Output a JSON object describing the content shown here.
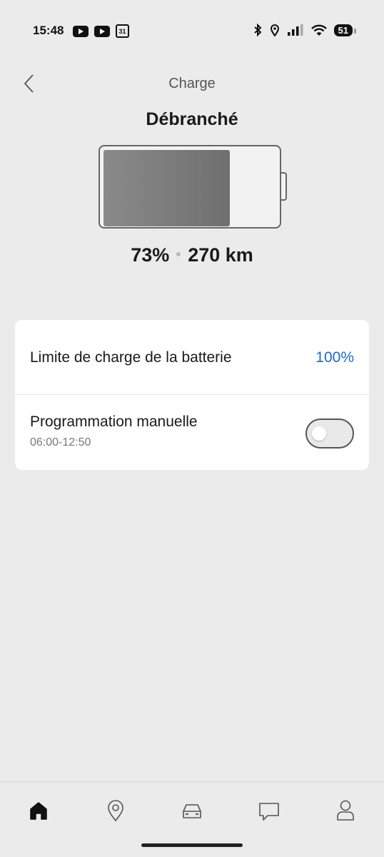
{
  "status_bar": {
    "time": "15:48",
    "calendar_day": "31",
    "battery_level": "51"
  },
  "header": {
    "title": "Charge",
    "state": "Débranché"
  },
  "battery": {
    "charge_fraction": 0.73,
    "percent_text": "73%",
    "range_text": "270 km"
  },
  "settings": {
    "charge_limit_label": "Limite de charge de la batterie",
    "charge_limit_value": "100%",
    "manual_schedule_label": "Programmation manuelle",
    "manual_schedule_time": "06:00-12:50",
    "manual_schedule_enabled": false
  },
  "nav": {
    "items": [
      "home-icon",
      "location-pin-icon",
      "car-icon",
      "chat-icon",
      "profile-icon"
    ],
    "active": "home-icon"
  },
  "colors": {
    "accent": "#1e6bc5",
    "background": "#ebebeb",
    "card": "#ffffff"
  }
}
